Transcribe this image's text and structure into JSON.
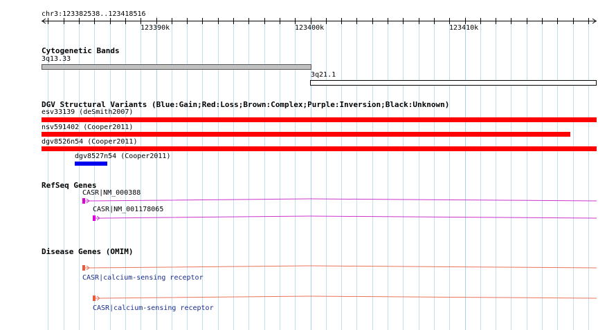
{
  "ruler": {
    "range_label": "chr3:123382538..123418516",
    "ticks": [
      "123390k",
      "123400k",
      "123410k"
    ]
  },
  "tracks": {
    "cytobands": {
      "title": "Cytogenetic Bands",
      "bands": [
        {
          "label": "3q13.33",
          "fill": "#c0c0c0",
          "stroke": "#555555"
        },
        {
          "label": "3q21.1",
          "fill": "#ffffff",
          "stroke": "#000000"
        }
      ]
    },
    "dgv": {
      "title": "DGV Structural Variants (Blue:Gain;Red:Loss;Brown:Complex;Purple:Inversion;Black:Unknown)",
      "variants": [
        {
          "label": "esv33139 (deSmith2007)",
          "color": "#ff0000",
          "type": "Loss"
        },
        {
          "label": "nsv591402 (Cooper2011)",
          "color": "#ff0000",
          "type": "Loss"
        },
        {
          "label": "dgv8526n54 (Cooper2011)",
          "color": "#ff0000",
          "type": "Loss"
        },
        {
          "label": "dgv8527n54 (Cooper2011)",
          "color": "#0000ee",
          "type": "Gain"
        }
      ]
    },
    "refseq": {
      "title": "RefSeq Genes",
      "color": "#cc33cc",
      "genes": [
        {
          "label": "CASR|NM_000388"
        },
        {
          "label": "CASR|NM_001178065"
        }
      ]
    },
    "omim": {
      "title": "Disease Genes (OMIM)",
      "color": "#e8735a",
      "genes": [
        {
          "label": "CASR|calcium-sensing receptor"
        },
        {
          "label": "CASR|calcium-sensing receptor"
        }
      ]
    }
  },
  "colors": {
    "grid_line": "#bfe0f0",
    "grid_line_major": "#a8d0e8",
    "refseq_exon": "#dd00dd",
    "omim_exon": "#f05a3c"
  }
}
